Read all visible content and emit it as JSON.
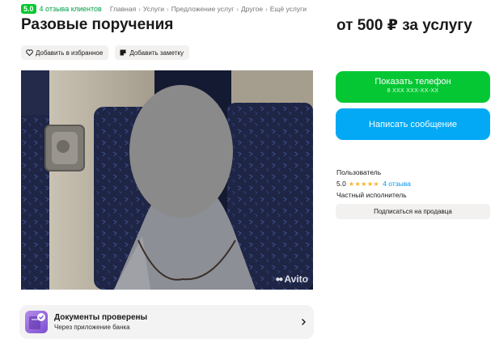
{
  "topbar": {
    "rating": "5.0",
    "reviews_text": "4 отзыва клиентов",
    "breadcrumbs": [
      "Главная",
      "Услуги",
      "Предложение услуг",
      "Другое",
      "Ещё услуги"
    ]
  },
  "listing": {
    "title": "Разовые поручения",
    "price": "от 500 ₽ за услугу"
  },
  "actions": {
    "favorite_label": "Добавить в избранное",
    "note_label": "Добавить заметку"
  },
  "photo": {
    "watermark": "Avito"
  },
  "docs": {
    "title": "Документы проверены",
    "subtitle": "Через приложение банка"
  },
  "contact": {
    "phone_label": "Показать телефон",
    "phone_masked": "8 XXX XXX-XX-XX",
    "message_label": "Написать сообщение"
  },
  "seller": {
    "name": "Пользователь",
    "rating": "5.0",
    "stars": "★★★★★",
    "reviews": "4 отзыва",
    "type": "Частный исполнитель",
    "subscribe_label": "Подписаться на продавца"
  },
  "colors": {
    "green": "#05c734",
    "blue": "#03a9f4",
    "rating_badge": "#04c72e",
    "star": "#ffb021"
  }
}
